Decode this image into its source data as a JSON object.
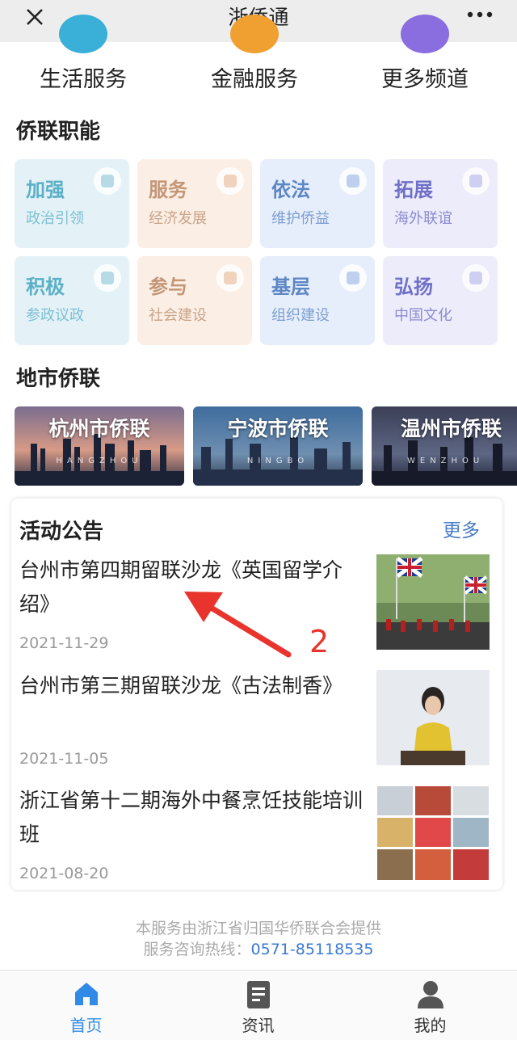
{
  "topbar": {
    "title": "浙侨通"
  },
  "channels": [
    {
      "label": "生活服务",
      "color": "#3ab0d8"
    },
    {
      "label": "金融服务",
      "color": "#f0a030"
    },
    {
      "label": "更多频道",
      "color": "#8a6ee0"
    }
  ],
  "functions": {
    "title": "侨联职能",
    "cards": [
      {
        "title": "加强",
        "subtitle": "政治引领",
        "tone": "teal"
      },
      {
        "title": "服务",
        "subtitle": "经济发展",
        "tone": "peach"
      },
      {
        "title": "依法",
        "subtitle": "维护侨益",
        "tone": "blue"
      },
      {
        "title": "拓展",
        "subtitle": "海外联谊",
        "tone": "violet"
      },
      {
        "title": "积极",
        "subtitle": "参政议政",
        "tone": "teal"
      },
      {
        "title": "参与",
        "subtitle": "社会建设",
        "tone": "peach"
      },
      {
        "title": "基层",
        "subtitle": "组织建设",
        "tone": "blue"
      },
      {
        "title": "弘扬",
        "subtitle": "中国文化",
        "tone": "violet"
      }
    ]
  },
  "cities": {
    "title": "地市侨联",
    "items": [
      {
        "name": "杭州市侨联",
        "pinyin": "HANGZHOU"
      },
      {
        "name": "宁波市侨联",
        "pinyin": "NINGBO"
      },
      {
        "name": "温州市侨联",
        "pinyin": "WENZHOU"
      }
    ]
  },
  "notices": {
    "title": "活动公告",
    "more": "更多",
    "items": [
      {
        "title": "台州市第四期留联沙龙《英国留学介绍》",
        "date": "2021-11-29"
      },
      {
        "title": "台州市第三期留联沙龙《古法制香》",
        "date": "2021-11-05"
      },
      {
        "title": "浙江省第十二期海外中餐烹饪技能培训班",
        "date": "2021-08-20"
      }
    ]
  },
  "annotation": {
    "number": "2"
  },
  "footer": {
    "provider": "本服务由浙江省归国华侨联合会提供",
    "hotline_label": "服务咨询热线：",
    "hotline": "0571-85118535"
  },
  "tabs": [
    {
      "label": "首页",
      "active": true
    },
    {
      "label": "资讯",
      "active": false
    },
    {
      "label": "我的",
      "active": false
    }
  ]
}
